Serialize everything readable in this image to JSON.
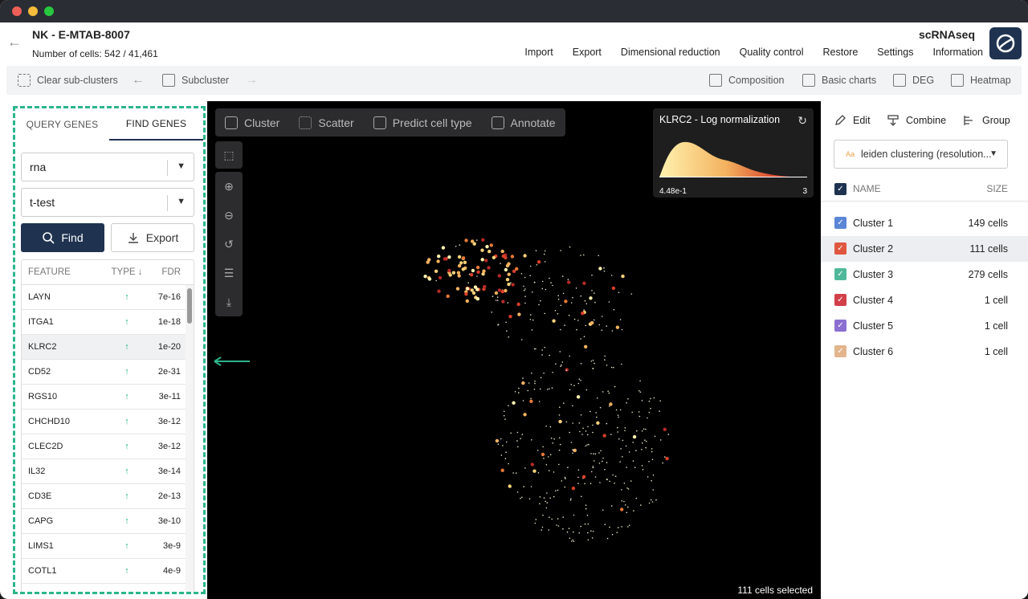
{
  "window": {
    "dots": [
      "#ee5f57",
      "#f5bd3a",
      "#27c840"
    ]
  },
  "header": {
    "title": "NK - E-MTAB-8007",
    "cell_count": "Number of cells: 542 / 41,461",
    "brand": "scRNAseq",
    "menu": [
      "Import",
      "Export",
      "Dimensional reduction",
      "Quality control",
      "Restore",
      "Settings",
      "Information"
    ]
  },
  "toolbar": {
    "clear": "Clear sub-clusters",
    "subcluster": "Subcluster",
    "composition": "Composition",
    "basic_charts": "Basic charts",
    "deg": "DEG",
    "heatmap": "Heatmap"
  },
  "left_panel": {
    "tabs": [
      "QUERY GENES",
      "FIND GENES"
    ],
    "modality": "rna",
    "test": "t-test",
    "find_label": "Find",
    "export_label": "Export",
    "columns": [
      "FEATURE",
      "TYPE ↓",
      "FDR"
    ],
    "rows": [
      {
        "feature": "LAYN",
        "type": "↑",
        "fdr": "7e-16"
      },
      {
        "feature": "ITGA1",
        "type": "↑",
        "fdr": "1e-18"
      },
      {
        "feature": "KLRC2",
        "type": "↑",
        "fdr": "1e-20"
      },
      {
        "feature": "CD52",
        "type": "↑",
        "fdr": "2e-31"
      },
      {
        "feature": "RGS10",
        "type": "↑",
        "fdr": "3e-11"
      },
      {
        "feature": "CHCHD10",
        "type": "↑",
        "fdr": "3e-12"
      },
      {
        "feature": "CLEC2D",
        "type": "↑",
        "fdr": "3e-12"
      },
      {
        "feature": "IL32",
        "type": "↑",
        "fdr": "3e-14"
      },
      {
        "feature": "CD3E",
        "type": "↑",
        "fdr": "2e-13"
      },
      {
        "feature": "CAPG",
        "type": "↑",
        "fdr": "3e-10"
      },
      {
        "feature": "LIMS1",
        "type": "↑",
        "fdr": "3e-9"
      },
      {
        "feature": "COTL1",
        "type": "↑",
        "fdr": "4e-9"
      }
    ],
    "highlighted_row": 2
  },
  "plot": {
    "tools": [
      "Cluster",
      "Scatter",
      "Predict cell type",
      "Annotate"
    ],
    "legend_title": "KLRC2 - Log normalization",
    "legend_min": "4.48e-1",
    "legend_max": "3",
    "selected": "111 cells selected"
  },
  "right_panel": {
    "edit": "Edit",
    "combine": "Combine",
    "group": "Group",
    "dropdown": "leiden clustering (resolution...",
    "name_header": "NAME",
    "size_header": "SIZE",
    "clusters": [
      {
        "name": "Cluster 1",
        "size": "149 cells",
        "color": "#5b86d6"
      },
      {
        "name": "Cluster 2",
        "size": "111 cells",
        "color": "#e0573f"
      },
      {
        "name": "Cluster 3",
        "size": "279 cells",
        "color": "#4fb89a"
      },
      {
        "name": "Cluster 4",
        "size": "1 cell",
        "color": "#d2404a"
      },
      {
        "name": "Cluster 5",
        "size": "1 cell",
        "color": "#8b6fd1"
      },
      {
        "name": "Cluster 6",
        "size": "1 cell",
        "color": "#e3b58d"
      }
    ],
    "highlighted_cluster": 1
  }
}
